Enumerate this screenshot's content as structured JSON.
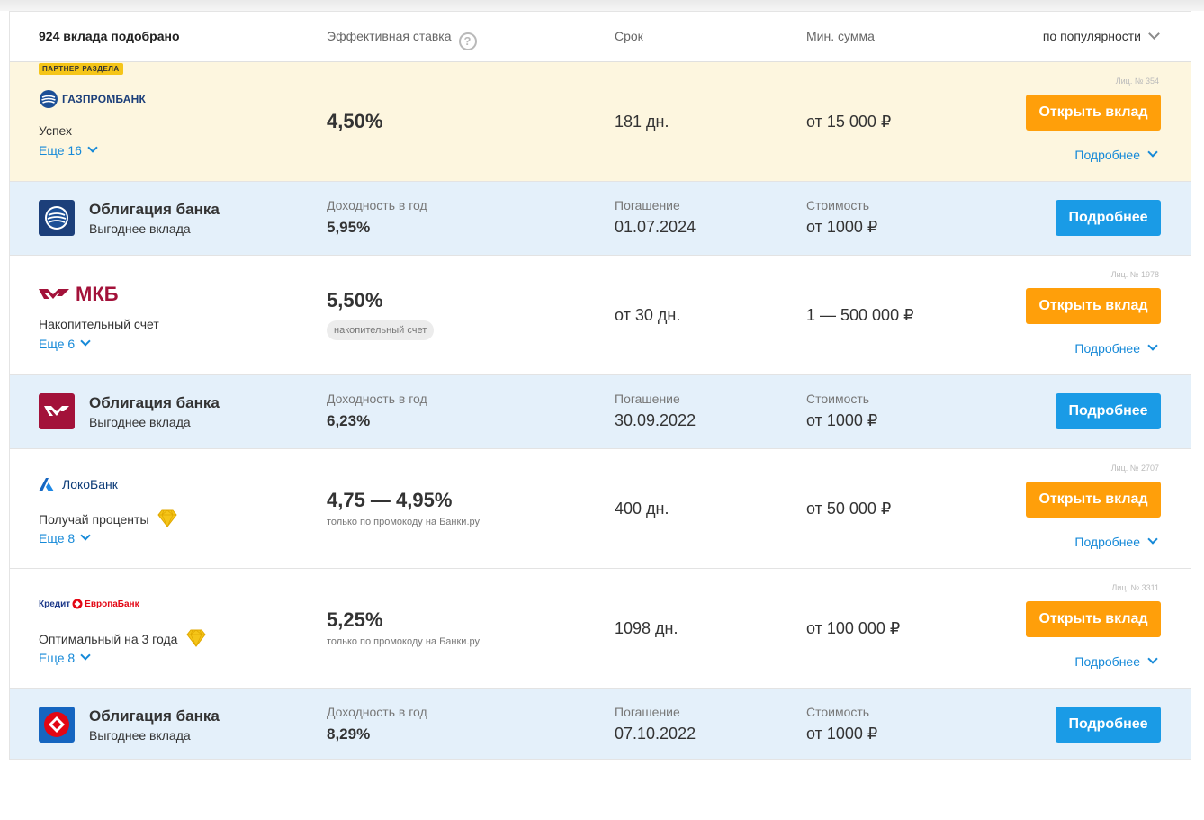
{
  "header": {
    "count": "924 вклада подобрано",
    "rate": "Эффективная ставка",
    "term": "Срок",
    "min_sum": "Мин. сумма",
    "sort": "по популярности"
  },
  "colors": {
    "accent_orange": "#ff9f0a",
    "accent_blue": "#1a9be6",
    "link": "#1589d8",
    "partner_bg": "#fdf6df",
    "bond_bg": "#e4f0fa"
  },
  "rows": [
    {
      "type": "deposit",
      "badge": "ПАРТНЕР РАЗДЕЛА",
      "bank": "ГАЗПРОМБАНК",
      "product": "Успех",
      "more": "Еще 16",
      "rate": "4,50%",
      "term": "181 дн.",
      "min_sum": "от 15 000 ₽",
      "license": "Лиц. № 354",
      "button": "Открыть вклад",
      "details": "Подробнее"
    },
    {
      "type": "bond",
      "title": "Облигация банка",
      "subtitle": "Выгоднее вклада",
      "yield_label": "Доходность в год",
      "yield": "5,95%",
      "maturity_label": "Погашение",
      "maturity": "01.07.2024",
      "cost_label": "Стоимость",
      "cost": "от 1000 ₽",
      "button": "Подробнее"
    },
    {
      "type": "deposit",
      "bank": "МКБ",
      "product": "Накопительный счет",
      "more": "Еще 6",
      "rate": "5,50%",
      "tag": "накопительный счет",
      "term": "от 30 дн.",
      "min_sum": "1 — 500 000 ₽",
      "license": "Лиц. № 1978",
      "button": "Открыть вклад",
      "details": "Подробнее"
    },
    {
      "type": "bond",
      "title": "Облигация банка",
      "subtitle": "Выгоднее вклада",
      "yield_label": "Доходность в год",
      "yield": "6,23%",
      "maturity_label": "Погашение",
      "maturity": "30.09.2022",
      "cost_label": "Стоимость",
      "cost": "от 1000 ₽",
      "button": "Подробнее"
    },
    {
      "type": "deposit",
      "bank": "ЛокоБанк",
      "product": "Получай проценты",
      "more": "Еще 8",
      "rate": "4,75 — 4,95%",
      "note": "только по промокоду на Банки.ру",
      "term": "400 дн.",
      "min_sum": "от 50 000 ₽",
      "license": "Лиц. № 2707",
      "button": "Открыть вклад",
      "details": "Подробнее"
    },
    {
      "type": "deposit",
      "bank_a": "Кредит",
      "bank_b": "ЕвропаБанк",
      "product": "Оптимальный на 3 года",
      "more": "Еще 8",
      "rate": "5,25%",
      "note": "только по промокоду на Банки.ру",
      "term": "1098 дн.",
      "min_sum": "от 100 000 ₽",
      "license": "Лиц. № 3311",
      "button": "Открыть вклад",
      "details": "Подробнее"
    },
    {
      "type": "bond",
      "title": "Облигация банка",
      "subtitle": "Выгоднее вклада",
      "yield_label": "Доходность в год",
      "yield": "8,29%",
      "maturity_label": "Погашение",
      "maturity": "07.10.2022",
      "cost_label": "Стоимость",
      "cost": "от 1000 ₽",
      "button": "Подробнее"
    }
  ]
}
